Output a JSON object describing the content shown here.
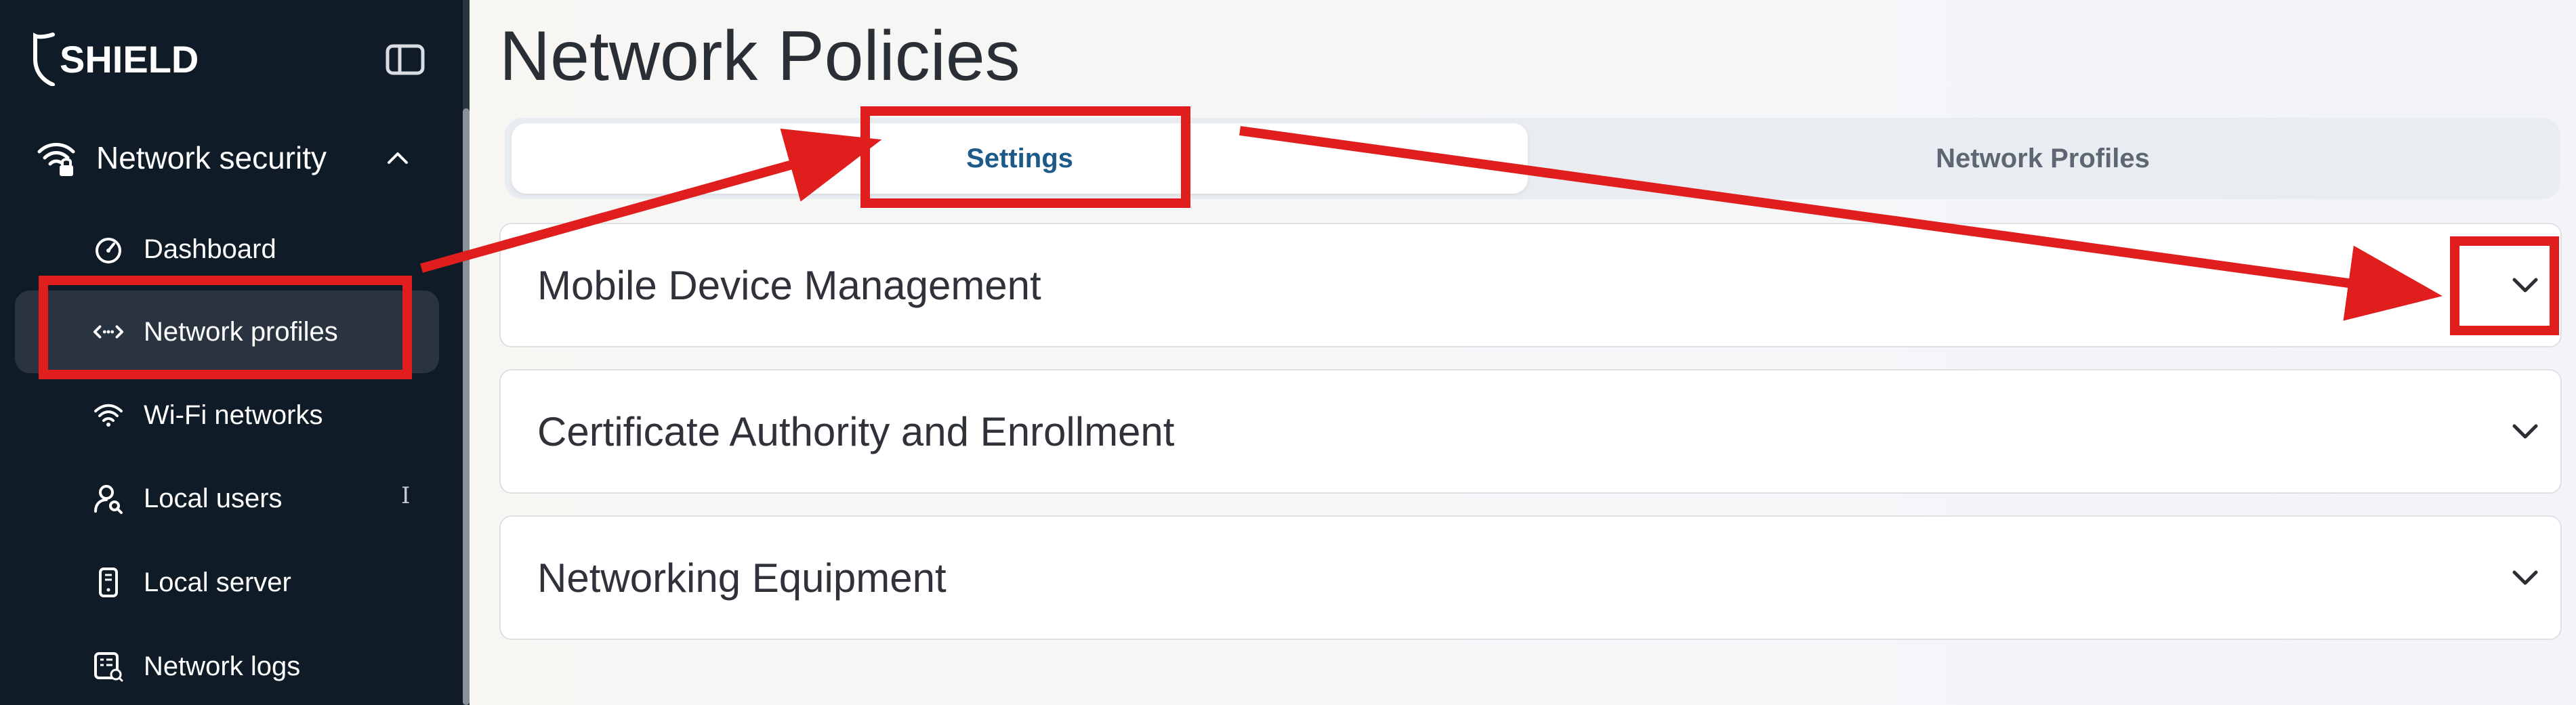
{
  "app": {
    "logo_text": "SHIELD"
  },
  "sidebar": {
    "group": {
      "label": "Network security",
      "expanded": true
    },
    "items": [
      {
        "label": "Dashboard",
        "icon": "gauge-icon"
      },
      {
        "label": "Network profiles",
        "icon": "network-code-icon",
        "active": true
      },
      {
        "label": "Wi-Fi networks",
        "icon": "wifi-icon"
      },
      {
        "label": "Local users",
        "icon": "user-key-icon"
      },
      {
        "label": "Local server",
        "icon": "server-device-icon"
      },
      {
        "label": "Network logs",
        "icon": "logs-icon"
      }
    ]
  },
  "main": {
    "title": "Network Policies",
    "tabs": [
      {
        "label": "Settings",
        "selected": true
      },
      {
        "label": "Network Profiles",
        "selected": false
      }
    ],
    "panels": [
      {
        "title": "Mobile Device Management",
        "expanded": false
      },
      {
        "title": "Certificate Authority and Enrollment",
        "expanded": false
      },
      {
        "title": "Networking Equipment",
        "expanded": false
      }
    ]
  },
  "colors": {
    "sidebar_bg": "#0f1b26",
    "active_item_bg": "#2a3440",
    "tab_selected_text": "#1c5a8a",
    "annotation_red": "#e01e1e"
  }
}
